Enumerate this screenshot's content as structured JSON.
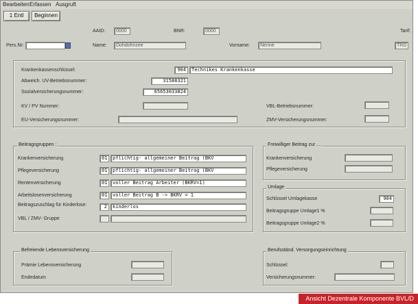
{
  "menu": {
    "items": [
      "Bearbeiten",
      "Erfassen",
      "Ausgruft"
    ]
  },
  "toolbar": {
    "first_button": "1 Entl",
    "second_button": "Beginnen"
  },
  "header": {
    "aaid_label": "AAID:",
    "aaid_value": "0000",
    "bnr_label": "BNR:",
    "bnr_value": "0000",
    "tarif_label": "Tarif:",
    "persnr_label": "Pers.Nr:",
    "persnr_value": "",
    "name_label": "Name:",
    "name_value": "Dohdohnzee",
    "vorname_label": "Vorname:",
    "vorname_value": "Nenne",
    "tarif_value": "TRD"
  },
  "kk": {
    "schluessel_label": "Krankenkassenschlüssel:",
    "schluessel_code": "904",
    "schluessel_name": "Technikes Krankenkasse",
    "betriebsnr_label": "Abweich. UV-Betriebsnummer:",
    "betriebsnr_value": "31588321",
    "svnr_label": "Sozialversicherungsnummer:",
    "svnr_value": "65653033824",
    "kv_pv_label": "KV / PV Nummer:",
    "kv_pv_value": "",
    "eu_label": "EU-Versicherungsnummer:",
    "eu_value": "",
    "vbl_betrieb_label": "VBL-Betriebsnummer:",
    "vbl_betrieb_value": "",
    "zmv_label": "ZMV-Versicherungsnummer:",
    "zmv_value": ""
  },
  "beitragsgruppen": {
    "title": "Beitragsgruppen :",
    "rows": [
      {
        "label": "Krankenversicherung",
        "code": "01",
        "text": "pflichtig- allgemeiner Beitrag (BKV"
      },
      {
        "label": "Pflegeversicherung",
        "code": "01",
        "text": "pflichtig- allgemeiner Beitrag (BKV"
      },
      {
        "label": "Rentenversicherung",
        "code": "01",
        "text": "voller Beitrag Arbeiter (BKRV=1)"
      },
      {
        "label": "Arbeitslosenversicherung",
        "code": "01",
        "text": "voller Beitrag B -> BKRV = 1"
      },
      {
        "label": "Beitragszuschlag für Kinderlose:",
        "code": "2",
        "text": "kinderlos"
      },
      {
        "label": "VBL / ZMV- Gruppe",
        "code": "",
        "text": ""
      }
    ]
  },
  "freiwillig": {
    "title": "Freiwilliger Beitrag zur ...",
    "kv_label": "Krankenversicherung",
    "kv_value": "",
    "pv_label": "Pflegeversicherung",
    "pv_value": ""
  },
  "umlage": {
    "title": "Umlage",
    "kasse_label": "Schlüssel Umlagekasse",
    "kasse_value": "904",
    "u1_label": "Beitragsgruppe Umlage1 %",
    "u1_value": "",
    "u2_label": "Beitragsgruppe Umlage2 %",
    "u2_value": ""
  },
  "lebensvers": {
    "title": "Befreiende Lebensversicherung",
    "praemie_label": "Prämie Lebensversicherung",
    "praemie_value": "",
    "ende_label": "Endedatum",
    "ende_value": ""
  },
  "berufsst": {
    "title": "Berufsständ. Versorgungseinrichtung",
    "schluessel_label": "Schlüssel:",
    "schluessel_value": "",
    "versnr_label": "Versicherungsnummer:",
    "versnr_value": ""
  },
  "caption": "Ansicht Dezentrale Komponente BVL/D"
}
